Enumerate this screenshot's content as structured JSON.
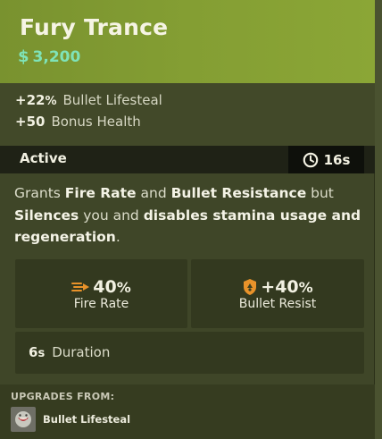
{
  "item": {
    "name": "Fury Trance",
    "cost": "3,200",
    "currency_icon": "souls-icon"
  },
  "passives": [
    {
      "value": "+22",
      "unit": "%",
      "label": "Bullet Lifesteal"
    },
    {
      "value": "+50",
      "unit": "",
      "label": "Bonus Health"
    }
  ],
  "active": {
    "label": "Active",
    "cooldown": "16s",
    "cooldown_icon": "cooldown-clock-icon"
  },
  "description": {
    "t1": "Grants ",
    "b1": "Fire Rate",
    "t2": " and ",
    "b2": "Bullet Resistance",
    "t3": " but ",
    "b3": "Silences",
    "t4": " you and ",
    "b4": "disables stamina usage and regeneration",
    "t5": "."
  },
  "effects": {
    "fire_rate": {
      "value": "40",
      "unit": "%",
      "label": "Fire Rate",
      "icon": "fire-rate-icon"
    },
    "bullet_resist": {
      "value": "+40",
      "unit": "%",
      "label": "Bullet Resist",
      "icon": "bullet-resist-shield-icon"
    },
    "duration": {
      "value": "6",
      "unit": "s",
      "label": "Duration"
    }
  },
  "upgrades": {
    "title": "UPGRADES FROM:",
    "items": [
      {
        "label": "Bullet Lifesteal",
        "icon": "bullet-lifesteal-icon"
      }
    ]
  },
  "colors": {
    "header_green": "#849e33",
    "cost_teal": "#7fe3b8",
    "body_olive": "#3f4628",
    "icon_orange": "#e8922a"
  }
}
